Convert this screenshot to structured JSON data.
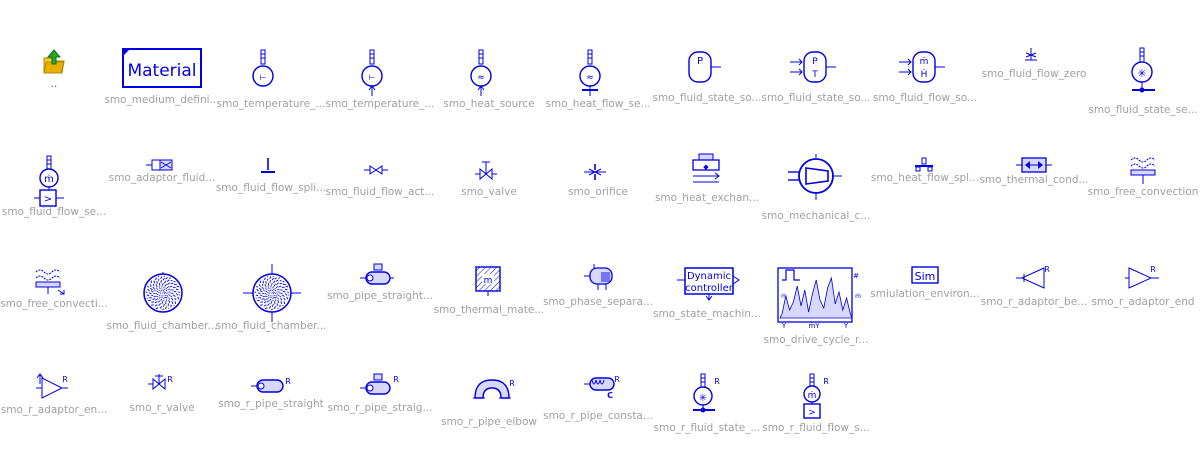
{
  "window": {
    "title": ""
  },
  "colors": {
    "icon": "#0000e0",
    "label": "#a0a0a0",
    "fill_light": "#d8d8ff",
    "folder": "#e8b000",
    "arrow": "#22aa22"
  },
  "library": {
    "items": [
      {
        "label": "..",
        "icon": "folder-up-icon"
      },
      {
        "label": "smo_medium_defini...",
        "icon": "material-icon",
        "text": "Material"
      },
      {
        "label": "smo_temperature_...",
        "icon": "temperature-sensor-icon",
        "text": "T"
      },
      {
        "label": "smo_temperature_...",
        "icon": "temperature-source-icon",
        "text": "T"
      },
      {
        "label": "smo_heat_source",
        "icon": "heat-source-icon",
        "text": "Q"
      },
      {
        "label": "smo_heat_flow_se...",
        "icon": "heat-flow-sensor-icon",
        "text": "Q"
      },
      {
        "label": "smo_fluid_state_so...",
        "icon": "fluid-state-source-p-icon",
        "text": "P"
      },
      {
        "label": "smo_fluid_state_so...",
        "icon": "fluid-state-source-pt-icon",
        "text": "P T"
      },
      {
        "label": "smo_fluid_flow_so...",
        "icon": "fluid-flow-source-icon",
        "text": "ṁ Ḣ"
      },
      {
        "label": "smo_fluid_flow_zero",
        "icon": "fluid-flow-zero-icon"
      },
      {
        "label": "smo_fluid_state_se...",
        "icon": "fluid-state-sensor-icon",
        "text": "*"
      },
      {
        "label": "smo_fluid_flow_se...",
        "icon": "fluid-flow-sensor-icon",
        "text": "ṁ"
      },
      {
        "label": "smo_adaptor_fluid...",
        "icon": "adaptor-fluid-icon"
      },
      {
        "label": "smo_fluid_flow_spli...",
        "icon": "fluid-flow-split-icon"
      },
      {
        "label": "smo_fluid_flow_act...",
        "icon": "fluid-flow-actuator-icon"
      },
      {
        "label": "smo_valve",
        "icon": "valve-icon"
      },
      {
        "label": "smo_orifice",
        "icon": "orifice-icon"
      },
      {
        "label": "smo_heat_exchan...",
        "icon": "heat-exchanger-icon"
      },
      {
        "label": "smo_mechanical_c...",
        "icon": "mechanical-compressor-icon"
      },
      {
        "label": "smo_heat_flow_spl...",
        "icon": "heat-flow-split-icon"
      },
      {
        "label": "smo_thermal_cond...",
        "icon": "thermal-conductor-icon"
      },
      {
        "label": "smo_free_convection",
        "icon": "free-convection-icon"
      },
      {
        "label": "smo_free_convecti...",
        "icon": "free-convection-2-icon"
      },
      {
        "label": "smo_fluid_chamber...",
        "icon": "fluid-chamber-icon"
      },
      {
        "label": "smo_fluid_chamber...",
        "icon": "fluid-chamber-ports-icon"
      },
      {
        "label": "smo_pipe_straight...",
        "icon": "pipe-straight-icon"
      },
      {
        "label": "smo_thermal_mate...",
        "icon": "thermal-material-icon",
        "text": "m"
      },
      {
        "label": "smo_phase_separa...",
        "icon": "phase-separator-icon"
      },
      {
        "label": "smo_state_machin...",
        "icon": "state-machine-icon",
        "text": "Dynamic controller"
      },
      {
        "label": "smo_drive_cycle_r...",
        "icon": "drive-cycle-icon",
        "text": "ṁ"
      },
      {
        "label": "smiulation_environ...",
        "icon": "simulation-environment-icon",
        "text": "Sim"
      },
      {
        "label": "smo_r_adaptor_be...",
        "icon": "r-adaptor-begin-icon",
        "text": "R"
      },
      {
        "label": "smo_r_adaptor_end",
        "icon": "r-adaptor-end-icon",
        "text": "R"
      },
      {
        "label": "smo_r_adaptor_en...",
        "icon": "r-adaptor-energy-icon",
        "text": "R"
      },
      {
        "label": "smo_r_valve",
        "icon": "r-valve-icon",
        "text": "R"
      },
      {
        "label": "smo_r_pipe_straight",
        "icon": "r-pipe-straight-icon",
        "text": "R"
      },
      {
        "label": "smo_r_pipe_straig...",
        "icon": "r-pipe-straight-2-icon",
        "text": "R"
      },
      {
        "label": "smo_r_pipe_elbow",
        "icon": "r-pipe-elbow-icon",
        "text": "R"
      },
      {
        "label": "smo_r_pipe_consta...",
        "icon": "r-pipe-constant-icon",
        "text": "R"
      },
      {
        "label": "smo_r_fluid_state_...",
        "icon": "r-fluid-state-icon",
        "text": "R"
      },
      {
        "label": "smo_r_fluid_flow_s...",
        "icon": "r-fluid-flow-icon",
        "text": "R"
      }
    ]
  }
}
